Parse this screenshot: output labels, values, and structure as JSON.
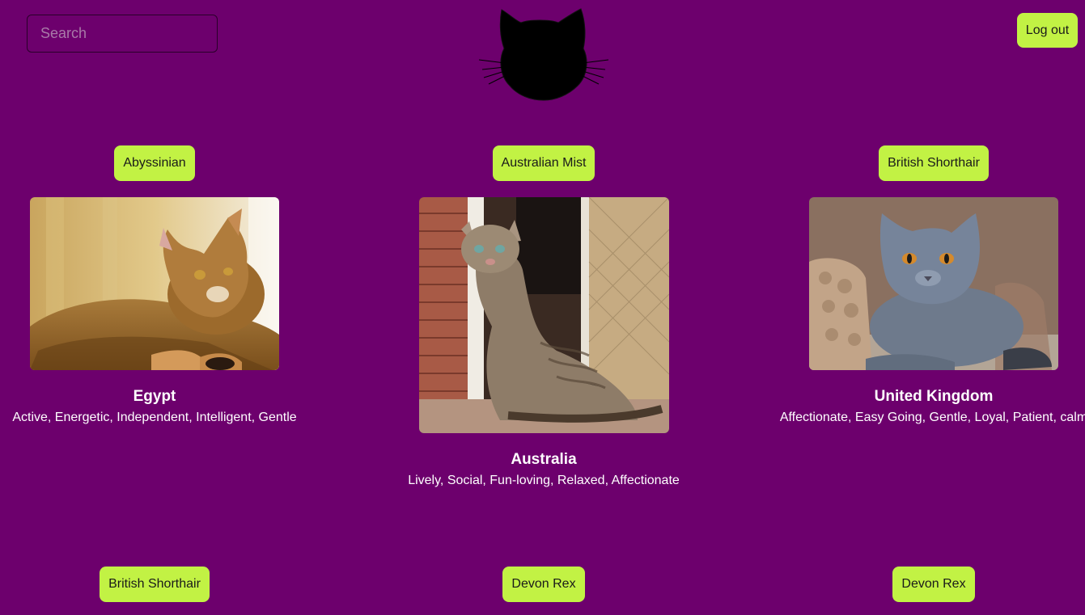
{
  "header": {
    "search_placeholder": "Search",
    "logo_icon": "cat-head-icon",
    "logout_label": "Log out"
  },
  "cards": [
    {
      "breed": "Abyssinian",
      "origin": "Egypt",
      "temperament": "Active, Energetic, Independent, Intelligent, Gentle"
    },
    {
      "breed": "Australian Mist",
      "origin": "Australia",
      "temperament": "Lively, Social, Fun-loving, Relaxed, Affectionate"
    },
    {
      "breed": "British Shorthair",
      "origin": "United Kingdom",
      "temperament": "Affectionate, Easy Going, Gentle, Loyal, Patient, calm"
    }
  ],
  "next_row": [
    {
      "breed": "British Shorthair"
    },
    {
      "breed": "Devon Rex"
    },
    {
      "breed": "Devon Rex"
    }
  ],
  "colors": {
    "background": "#6d006d",
    "button": "#c2f244"
  }
}
